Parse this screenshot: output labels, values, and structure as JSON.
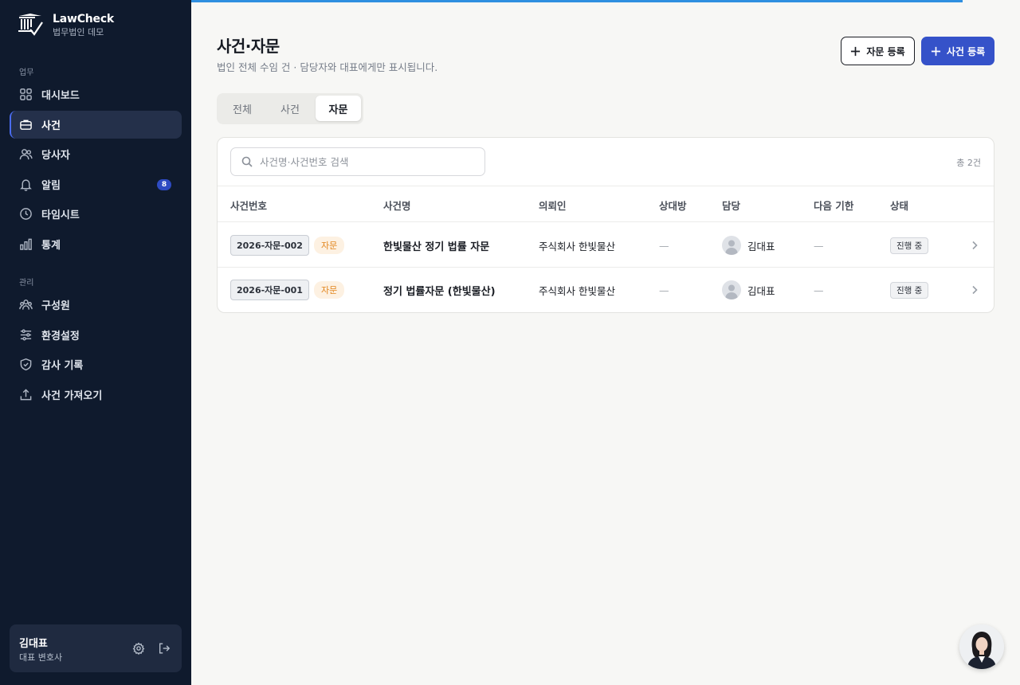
{
  "brand": {
    "name": "LawCheck",
    "subtitle": "법무법인 데모"
  },
  "sidebar": {
    "section_work": "업무",
    "section_admin": "관리",
    "items": [
      {
        "label": "대시보드",
        "icon": "grid-icon"
      },
      {
        "label": "사건",
        "icon": "briefcase-icon",
        "active": true
      },
      {
        "label": "당사자",
        "icon": "users-icon"
      },
      {
        "label": "알림",
        "icon": "bell-icon",
        "badge": "8"
      },
      {
        "label": "타임시트",
        "icon": "clock-icon"
      },
      {
        "label": "통계",
        "icon": "bar-chart-icon"
      },
      {
        "label": "구성원",
        "icon": "team-icon"
      },
      {
        "label": "환경설정",
        "icon": "sliders-icon"
      },
      {
        "label": "감사 기록",
        "icon": "shield-icon"
      },
      {
        "label": "사건 가져오기",
        "icon": "upload-icon"
      }
    ]
  },
  "user": {
    "name": "김대표",
    "role": "대표 변호사"
  },
  "header": {
    "title": "사건·자문",
    "subtitle": "법인 전체 수임 건 · 담당자와 대표에게만 표시됩니다.",
    "btn_advice": "자문 등록",
    "btn_case": "사건 등록"
  },
  "tabs": [
    {
      "label": "전체"
    },
    {
      "label": "사건"
    },
    {
      "label": "자문",
      "active": true
    }
  ],
  "search": {
    "placeholder": "사건명·사건번호 검색",
    "value": ""
  },
  "total": "총 2건",
  "table": {
    "headers": [
      "사건번호",
      "사건명",
      "의뢰인",
      "상대방",
      "담당",
      "다음 기한",
      "상태"
    ],
    "rows": [
      {
        "case_no": "2026-자문-002",
        "type": "자문",
        "name": "한빛물산 정기 법률 자문",
        "client": "주식회사 한빛물산",
        "opponent": "—",
        "owner": "김대표",
        "deadline": "—",
        "status": "진행 중"
      },
      {
        "case_no": "2026-자문-001",
        "type": "자문",
        "name": "정기 법률자문 (한빛물산)",
        "client": "주식회사 한빛물산",
        "opponent": "—",
        "owner": "김대표",
        "deadline": "—",
        "status": "진행 중"
      }
    ]
  },
  "colors": {
    "sidebar_bg": "#0f1a2d",
    "primary": "#3552c9",
    "accent_line": "#2f8fe0",
    "type_badge": "#e2861e"
  }
}
